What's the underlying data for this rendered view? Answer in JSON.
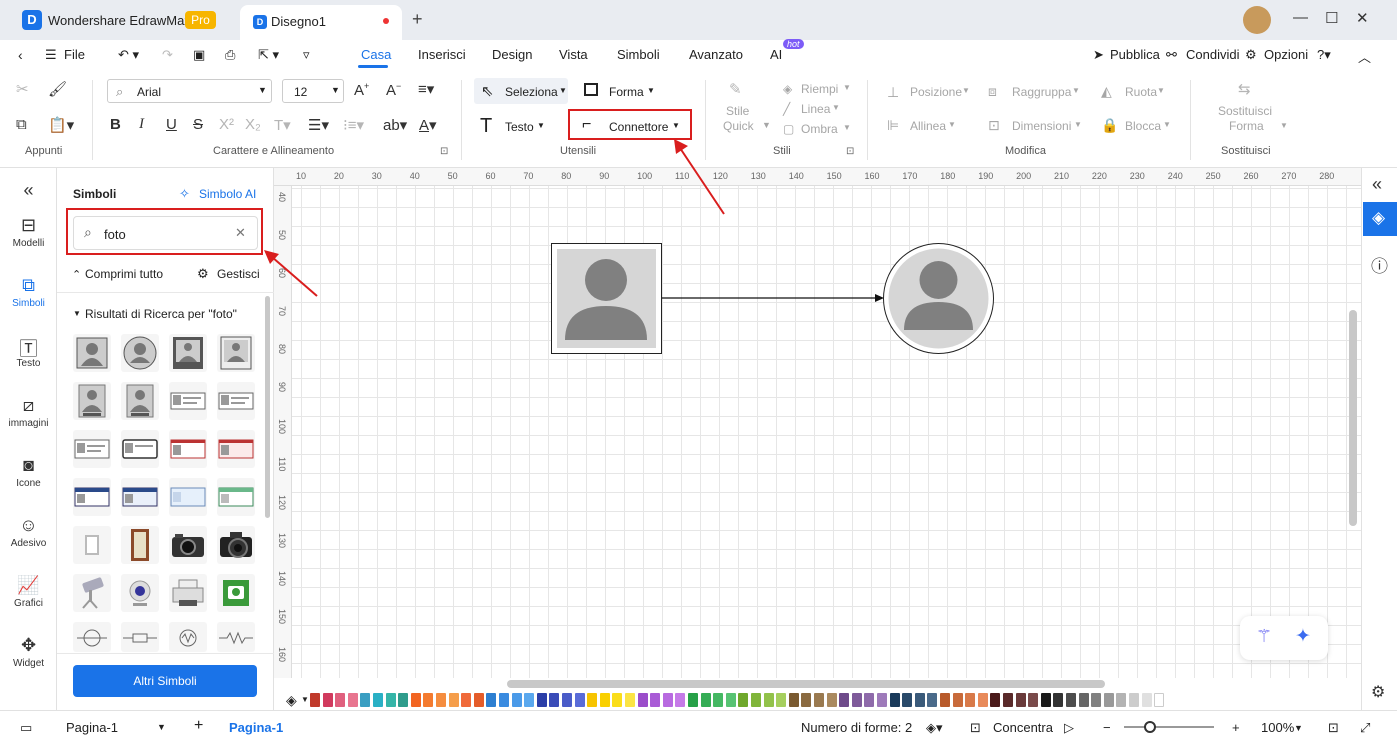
{
  "titlebar": {
    "app_name": "Wondershare EdrawMax",
    "pro_badge": "Pro",
    "doc_title": "Disegno1"
  },
  "menubar": {
    "file": "File",
    "tabs": [
      "Casa",
      "Inserisci",
      "Design",
      "Vista",
      "Simboli",
      "Avanzato",
      "AI"
    ],
    "ai_badge": "hot",
    "publish": "Pubblica",
    "share": "Condividi",
    "options": "Opzioni"
  },
  "ribbon": {
    "clipboard_label": "Appunti",
    "font_name": "Arial",
    "font_size": "12",
    "font_group_label": "Carattere e Allineamento",
    "select": "Seleziona",
    "shape": "Forma",
    "text": "Testo",
    "connector": "Connettore",
    "tools_label": "Utensili",
    "quick_style_1": "Stile",
    "quick_style_2": "Quick",
    "fill": "Riempi",
    "line": "Linea",
    "shadow": "Ombra",
    "styles_label": "Stili",
    "position": "Posizione",
    "group": "Raggruppa",
    "rotate": "Ruota",
    "align": "Allinea",
    "size": "Dimensioni",
    "lock": "Blocca",
    "modify_label": "Modifica",
    "replace_shape_1": "Sostituisci",
    "replace_shape_2": "Forma",
    "replace_label": "Sostituisci"
  },
  "leftnav": [
    {
      "label": "Modelli"
    },
    {
      "label": "Simboli"
    },
    {
      "label": "Testo"
    },
    {
      "label": "immagini"
    },
    {
      "label": "Icone"
    },
    {
      "label": "Adesivo"
    },
    {
      "label": "Grafici"
    },
    {
      "label": "Widget"
    }
  ],
  "symbols": {
    "title": "Simboli",
    "ai_symbol": "Simbolo AI",
    "search_value": "foto",
    "collapse_all": "Comprimi tutto",
    "manage": "Gestisci",
    "results_label": "Risultati di Ricerca per  \"foto\"",
    "more_button": "Altri Simboli"
  },
  "ruler": {
    "h_ticks": [
      "10",
      "20",
      "30",
      "40",
      "50",
      "60",
      "70",
      "80",
      "90",
      "100",
      "110",
      "120",
      "130",
      "140",
      "150",
      "160",
      "170",
      "180",
      "190",
      "200",
      "210",
      "220",
      "230",
      "240",
      "250",
      "260",
      "270",
      "280"
    ],
    "v_ticks": [
      "40",
      "50",
      "60",
      "70",
      "80",
      "90",
      "100",
      "110",
      "120",
      "130",
      "140",
      "150",
      "160"
    ]
  },
  "colors": {
    "accent": "#1a73e8",
    "highlight": "#d91e1e",
    "palette": [
      "#c0392b",
      "#d13a5e",
      "#e0607e",
      "#e8758f",
      "#3a9ec2",
      "#2ab0c5",
      "#35b5a8",
      "#2f9c8c",
      "#f26522",
      "#f47b2f",
      "#f58d3f",
      "#f59e4b",
      "#f06a3a",
      "#e45c2a",
      "#2d7fd1",
      "#3a8be0",
      "#4a9ae8",
      "#5aa8ee",
      "#2b3ea8",
      "#3a4cb8",
      "#4a5cc8",
      "#5a6cd8",
      "#f7c400",
      "#f9d000",
      "#fadd1a",
      "#fbe444",
      "#9b4dca",
      "#a95bd6",
      "#b86ae0",
      "#c67ae8",
      "#27a048",
      "#35ad55",
      "#45b863",
      "#58c373",
      "#6fa82c",
      "#80b53a",
      "#92c24a",
      "#a6cf5e",
      "#7a5a30",
      "#8a6a40",
      "#9a7a50",
      "#aa8a60",
      "#6e4a8a",
      "#7e5a9a",
      "#8e6aaa",
      "#9e7aba",
      "#1a3a5a",
      "#2a4a6a",
      "#3a5a7a",
      "#4a6a8a",
      "#b85a2a",
      "#c86a3a",
      "#d87a4a",
      "#e88a5a",
      "#4a1a1a",
      "#5a2a2a",
      "#6a3a3a",
      "#7a4a4a",
      "#1a1a1a",
      "#333333",
      "#4d4d4d",
      "#666666",
      "#808080",
      "#999999",
      "#b3b3b3",
      "#cccccc",
      "#e0e0e0",
      "#ffffff"
    ]
  },
  "statusbar": {
    "page_select": "Pagina-1",
    "page_tab": "Pagina-1",
    "shape_count": "Numero di forme: 2",
    "focus": "Concentra",
    "zoom": "100%"
  }
}
